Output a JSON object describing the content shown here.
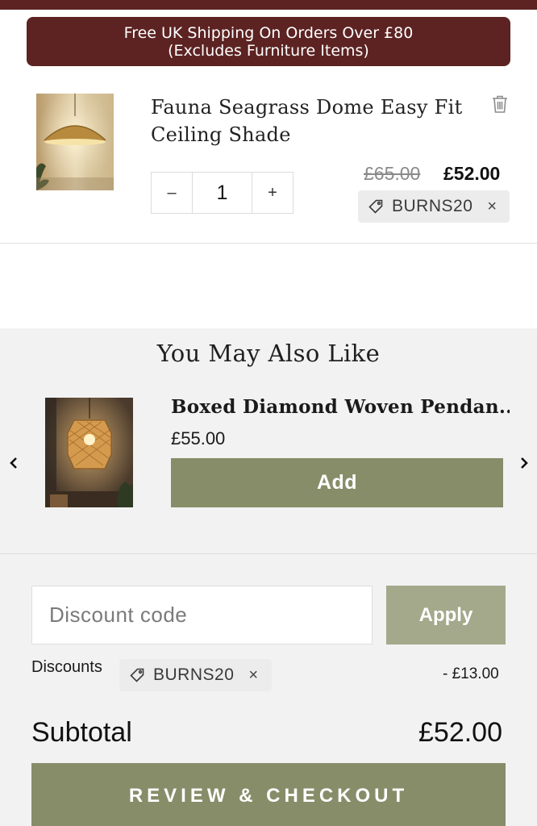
{
  "banner": {
    "line1": "Free UK Shipping On Orders Over £80",
    "line2": "(Excludes Furniture Items)"
  },
  "cart_item": {
    "title": "Fauna Seagrass Dome Easy Fit Ceiling Shade",
    "quantity": "1",
    "qty_minus": "–",
    "qty_plus": "+",
    "price_original": "£65.00",
    "price_sale": "£52.00",
    "discount_code": "BURNS20",
    "remove_code": "×"
  },
  "recommendations": {
    "heading": "You May Also Like",
    "product": {
      "title": "Boxed Diamond Woven Pendan...",
      "price": "£55.00",
      "add_label": "Add"
    }
  },
  "discount": {
    "placeholder": "Discount code",
    "apply_label": "Apply",
    "label": "Discounts",
    "code": "BURNS20",
    "remove": "×",
    "amount": "- £13.00"
  },
  "summary": {
    "subtotal_label": "Subtotal",
    "subtotal_value": "£52.00",
    "checkout_label": "REVIEW & CHECKOUT"
  },
  "colors": {
    "banner": "#5c2322",
    "button_olive": "#878d69",
    "button_olive_light": "#a4a98b",
    "panel_grey": "#f2f2f2"
  }
}
